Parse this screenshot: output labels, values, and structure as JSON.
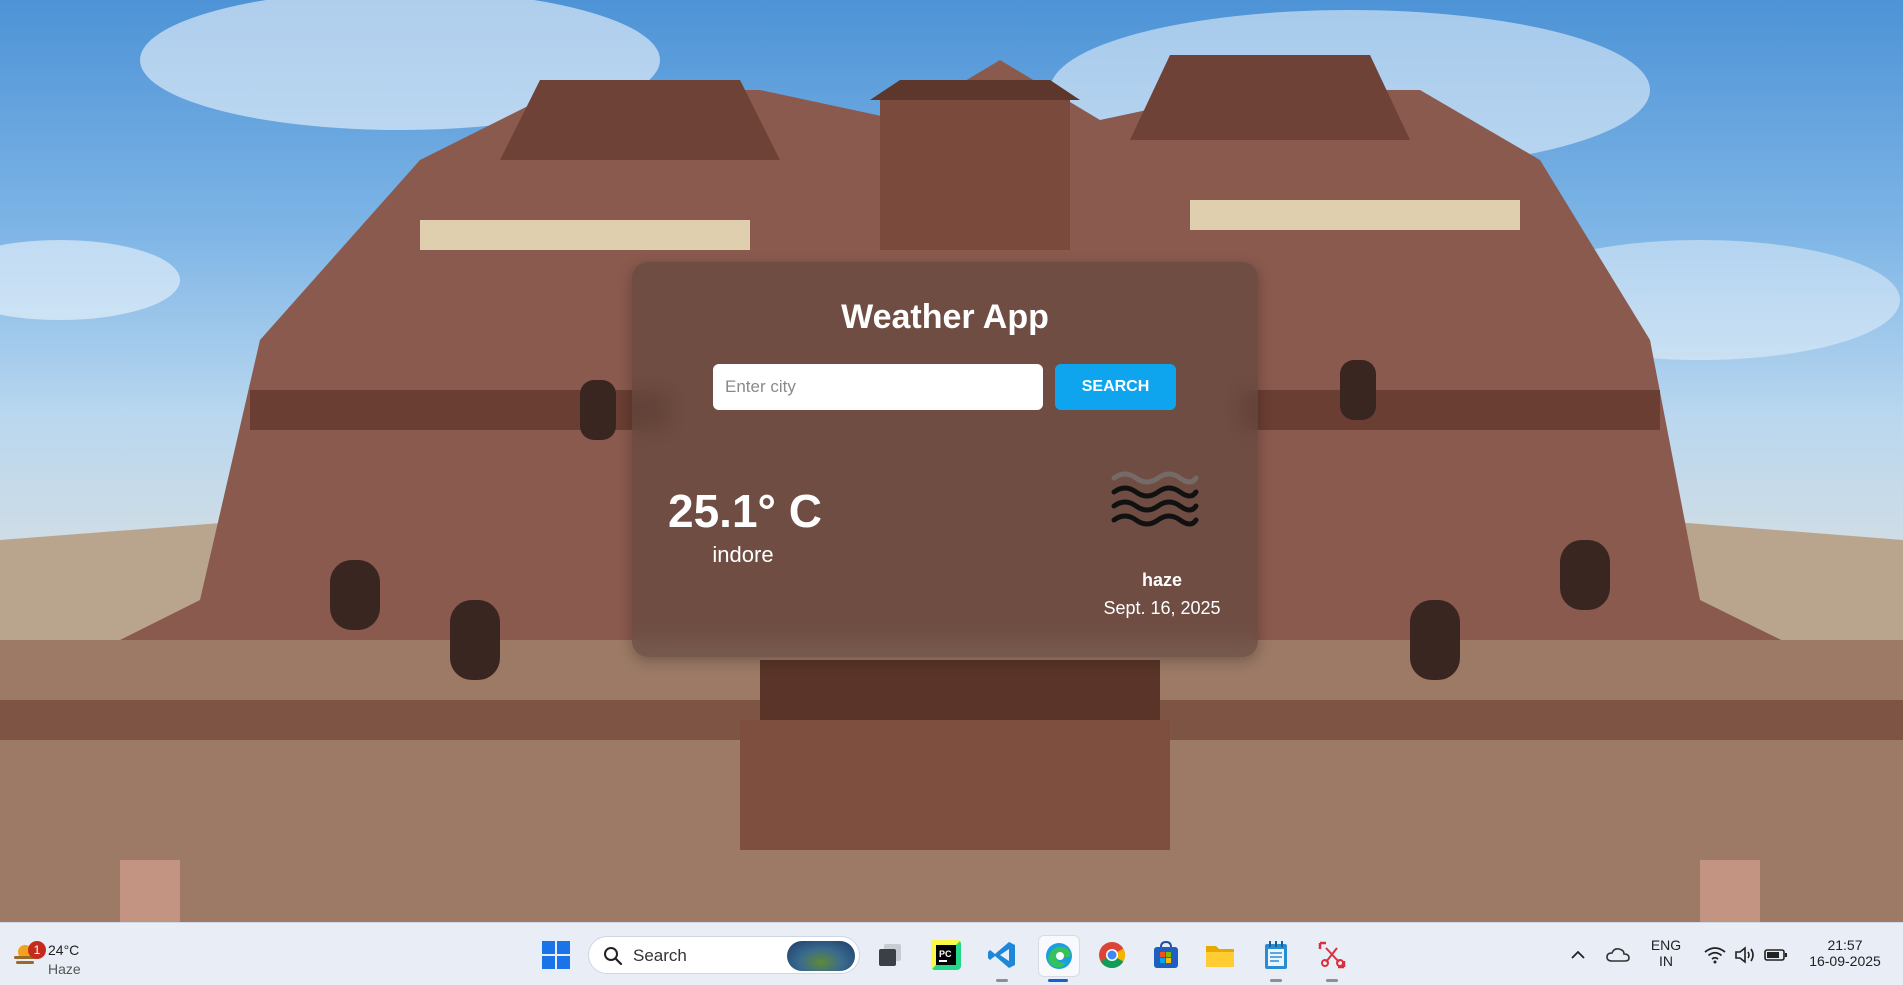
{
  "app": {
    "title": "Weather App",
    "search": {
      "placeholder": "Enter city",
      "value": "",
      "button_label": "SEARCH"
    },
    "current": {
      "temperature": "25.1° C",
      "city": "indore",
      "condition": "haze",
      "condition_icon": "haze-icon",
      "date": "Sept. 16, 2025"
    }
  },
  "taskbar": {
    "weather_widget": {
      "temp": "24°C",
      "condition": "Haze",
      "badge": "1"
    },
    "search_label": "Search",
    "pinned_apps": [
      "start-icon",
      "search",
      "task-view-icon",
      "pycharm-icon",
      "vscode-icon",
      "edge-icon",
      "chrome-icon",
      "store-icon",
      "file-explorer-icon",
      "notepad-icon",
      "snipping-tool-icon"
    ],
    "tray": {
      "language_top": "ENG",
      "language_bottom": "IN",
      "time": "21:57",
      "date": "16-09-2025"
    }
  },
  "colors": {
    "search_button": "#0ea5ee",
    "card_background": "rgba(95,70,62,0.62)",
    "taskbar": "#e8edf6"
  }
}
